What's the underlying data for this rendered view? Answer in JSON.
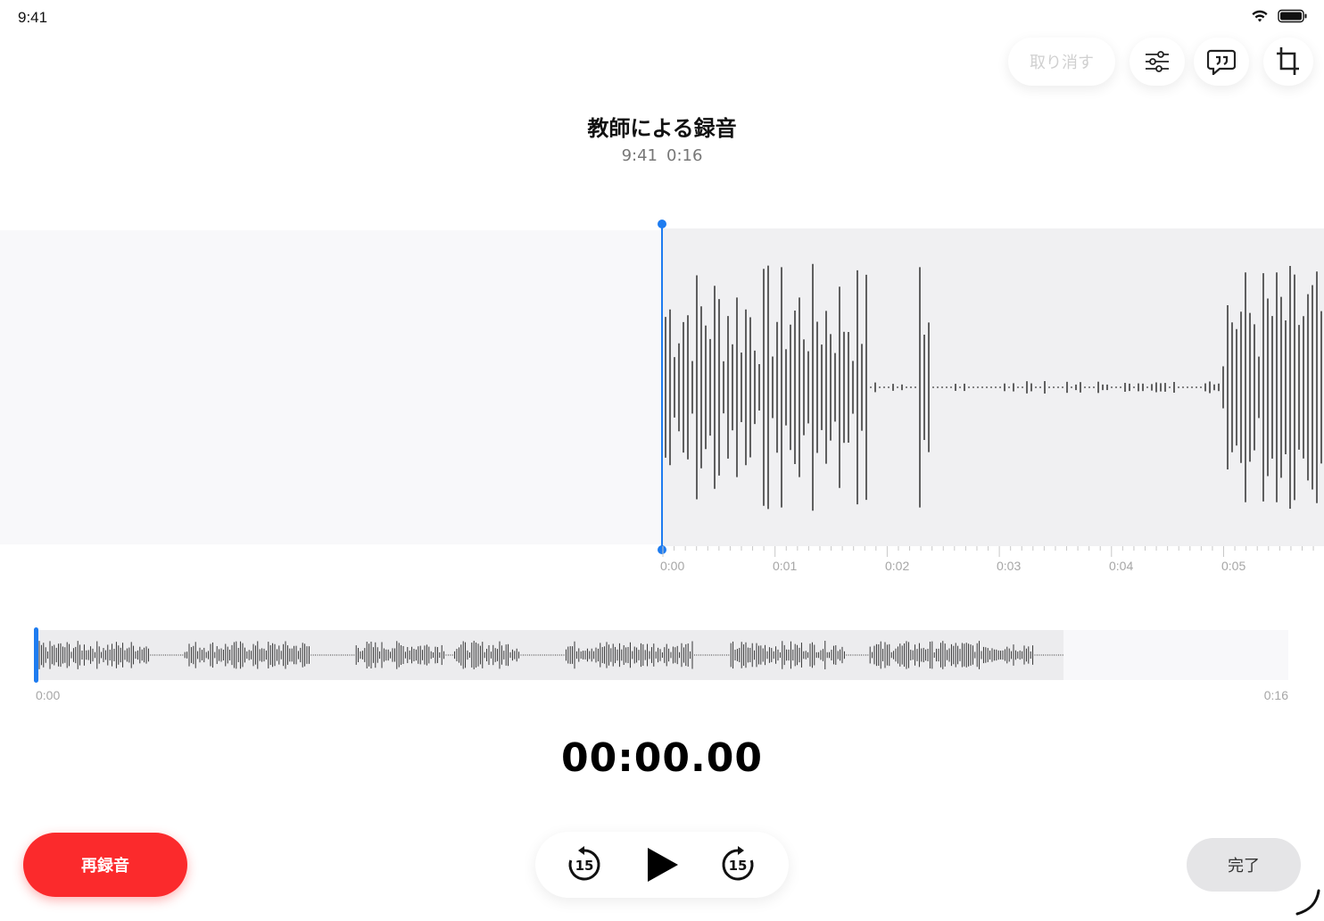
{
  "status": {
    "time": "9:41"
  },
  "toolbar": {
    "undo_label": "取り消す"
  },
  "recording": {
    "title": "教師による録音",
    "time": "9:41",
    "duration": "0:16"
  },
  "timeline": {
    "ticks": [
      "0:00",
      "0:01",
      "0:02",
      "0:03",
      "0:04",
      "0:05"
    ]
  },
  "overview": {
    "start": "0:00",
    "end": "0:16"
  },
  "timer": "00:00.00",
  "controls": {
    "rerecord_label": "再録音",
    "done_label": "完了",
    "skip_back_label": "15",
    "skip_forward_label": "15"
  },
  "colors": {
    "accent_blue": "#1e7cf0",
    "record_red": "#fb2a2c"
  }
}
